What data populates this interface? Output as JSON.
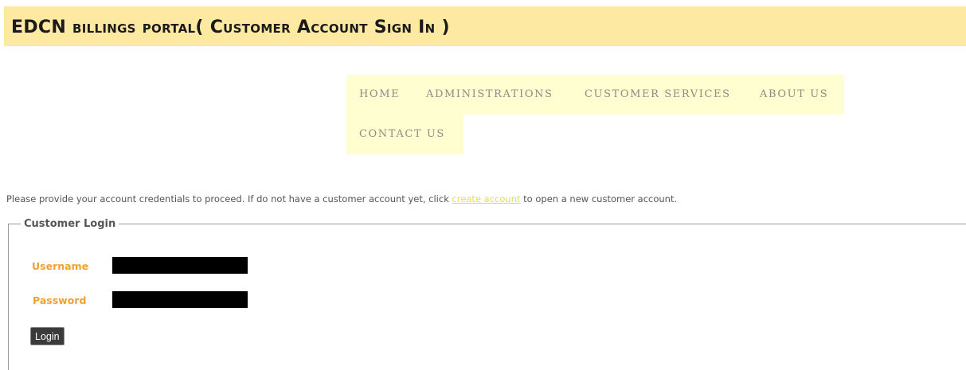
{
  "header": {
    "title": "EDCN billings portal( Customer Account Sign In )"
  },
  "nav": {
    "items": [
      {
        "label": "HOME"
      },
      {
        "label": "ADMINISTRATIONS"
      },
      {
        "label": "CUSTOMER SERVICES"
      },
      {
        "label": "ABOUT US"
      },
      {
        "label": "CONTACT US"
      }
    ]
  },
  "intro": {
    "text_before": "Please provide your account credentials to proceed. If do not have a customer account yet, click ",
    "link_label": "create account",
    "text_after": " to open a new customer account."
  },
  "login": {
    "legend": "Customer Login",
    "username_label": "Username",
    "username_value": "",
    "password_label": "Password",
    "password_value": "",
    "submit_label": "Login"
  },
  "colors": {
    "header_bg": "#fde9a2",
    "nav_bg": "#fffed1",
    "label_orange": "#f0a22e",
    "link_yellow": "#f2d55d"
  }
}
